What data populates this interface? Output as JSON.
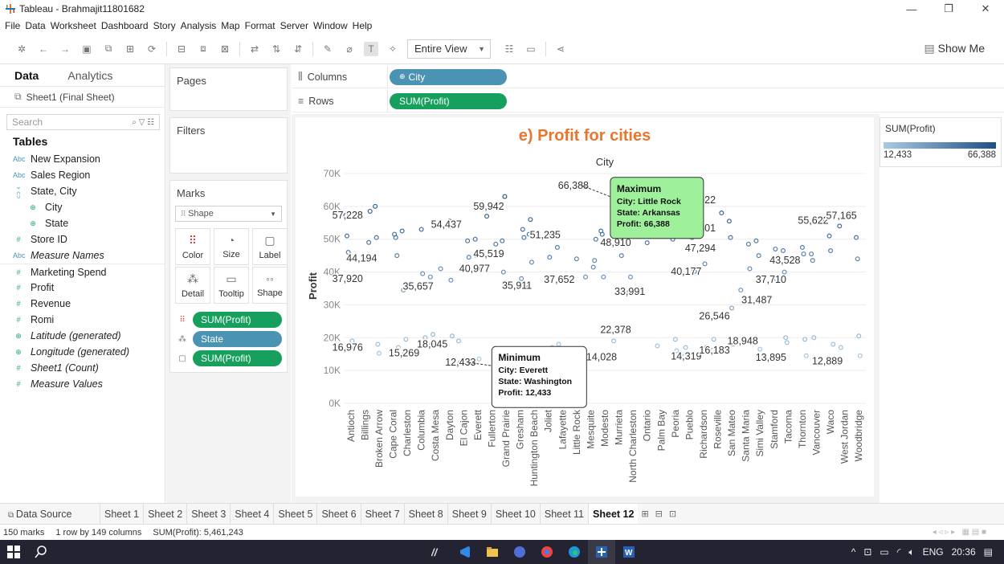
{
  "window": {
    "title": "Tableau - Brahmajit11801682",
    "minimize": "—",
    "restore": "❐",
    "close": "✕"
  },
  "menu": [
    "File",
    "Data",
    "Worksheet",
    "Dashboard",
    "Story",
    "Analysis",
    "Map",
    "Format",
    "Server",
    "Window",
    "Help"
  ],
  "toolbar": {
    "fit": "Entire View",
    "show_me": "Show Me"
  },
  "datapane": {
    "tab_data": "Data",
    "tab_analytics": "Analytics",
    "datasource": "Sheet1 (Final Sheet)",
    "search_placeholder": "Search",
    "tables_header": "Tables",
    "fields": [
      {
        "name": "New Expansion",
        "type": "Abc",
        "indent": false,
        "italic": false
      },
      {
        "name": "Sales Region",
        "type": "Abc",
        "indent": false,
        "italic": false
      },
      {
        "name": "State, City",
        "type": "hier",
        "indent": false,
        "italic": false
      },
      {
        "name": "City",
        "type": "geo",
        "indent": true,
        "italic": false
      },
      {
        "name": "State",
        "type": "geo",
        "indent": true,
        "italic": false
      },
      {
        "name": "Store ID",
        "type": "#",
        "indent": false,
        "italic": false
      },
      {
        "name": "Measure Names",
        "type": "Abc",
        "indent": false,
        "italic": true
      },
      {
        "name": "Marketing Spend",
        "type": "#",
        "indent": false,
        "italic": false
      },
      {
        "name": "Profit",
        "type": "#",
        "indent": false,
        "italic": false
      },
      {
        "name": "Revenue",
        "type": "#",
        "indent": false,
        "italic": false
      },
      {
        "name": "Romi",
        "type": "#",
        "indent": false,
        "italic": false
      },
      {
        "name": "Latitude (generated)",
        "type": "geo",
        "indent": false,
        "italic": true
      },
      {
        "name": "Longitude (generated)",
        "type": "geo",
        "indent": false,
        "italic": true
      },
      {
        "name": "Sheet1 (Count)",
        "type": "#",
        "indent": false,
        "italic": true
      },
      {
        "name": "Measure Values",
        "type": "#",
        "indent": false,
        "italic": true
      }
    ]
  },
  "cards": {
    "pages": "Pages",
    "filters": "Filters",
    "marks": "Marks",
    "mark_type": "Shape",
    "mark_buttons": [
      "Color",
      "Size",
      "Label",
      "Detail",
      "Tooltip",
      "Shape"
    ],
    "mark_pills": [
      {
        "icon": "color",
        "label": "SUM(Profit)",
        "kind": "green"
      },
      {
        "icon": "detail",
        "label": "State",
        "kind": "blue"
      },
      {
        "icon": "label",
        "label": "SUM(Profit)",
        "kind": "green"
      }
    ]
  },
  "shelves": {
    "columns_label": "Columns",
    "columns_pill": "City",
    "rows_label": "Rows",
    "rows_pill": "SUM(Profit)"
  },
  "legend": {
    "title": "SUM(Profit)",
    "min": "12,433",
    "max": "66,388"
  },
  "chart_data": {
    "type": "scatter",
    "title": "e) Profit for cities",
    "xlabel": "City",
    "ylabel": "Profit",
    "ylim": [
      0,
      70000
    ],
    "yticks": [
      "0K",
      "10K",
      "20K",
      "30K",
      "40K",
      "50K",
      "60K",
      "70K"
    ],
    "grid": true,
    "categories": [
      "Antioch",
      "Billings",
      "Broken Arrow",
      "Cape Coral",
      "Charleston",
      "Columbia",
      "Costa Mesa",
      "Dayton",
      "El Cajon",
      "Everett",
      "Fullerton",
      "Grand Prairie",
      "Gresham",
      "Huntington Beach",
      "Joliet",
      "Lafayette",
      "Little Rock",
      "Mesquite",
      "Modesto",
      "Murrieta",
      "North Charleston",
      "Ontario",
      "Palm Bay",
      "Peoria",
      "Pueblo",
      "Richardson",
      "Roseville",
      "San Mateo",
      "Santa Maria",
      "Simi Valley",
      "Stamford",
      "Tacoma",
      "Thornton",
      "Vancouver",
      "Waco",
      "West Jordan",
      "Woodbridge"
    ],
    "labels": [
      {
        "x": 0,
        "y": 57228,
        "text": "57,228"
      },
      {
        "x": 1,
        "y": 44194,
        "text": "44,194"
      },
      {
        "x": 0,
        "y": 37920,
        "text": "37,920"
      },
      {
        "x": 0,
        "y": 16976,
        "text": "16,976"
      },
      {
        "x": 4,
        "y": 15269,
        "text": "15,269"
      },
      {
        "x": 6,
        "y": 18045,
        "text": "18,045"
      },
      {
        "x": 5,
        "y": 35657,
        "text": "35,657"
      },
      {
        "x": 7,
        "y": 54437,
        "text": "54,437"
      },
      {
        "x": 10,
        "y": 59942,
        "text": "59,942"
      },
      {
        "x": 10,
        "y": 45519,
        "text": "45,519"
      },
      {
        "x": 9,
        "y": 40977,
        "text": "40,977"
      },
      {
        "x": 8,
        "y": 12433,
        "text": "12,433"
      },
      {
        "x": 12,
        "y": 35911,
        "text": "35,911"
      },
      {
        "x": 14,
        "y": 51235,
        "text": "51,235"
      },
      {
        "x": 15,
        "y": 37652,
        "text": "37,652"
      },
      {
        "x": 16,
        "y": 66388,
        "text": "66,388"
      },
      {
        "x": 19,
        "y": 48910,
        "text": "48,910"
      },
      {
        "x": 20,
        "y": 33991,
        "text": "33,991"
      },
      {
        "x": 19,
        "y": 22378,
        "text": "22,378"
      },
      {
        "x": 18,
        "y": 14028,
        "text": "14,028"
      },
      {
        "x": 25,
        "y": 61922,
        "text": "61,922"
      },
      {
        "x": 25,
        "y": 53301,
        "text": "53,301"
      },
      {
        "x": 25,
        "y": 47294,
        "text": "47,294"
      },
      {
        "x": 24,
        "y": 40177,
        "text": "40,177"
      },
      {
        "x": 26,
        "y": 26546,
        "text": "26,546"
      },
      {
        "x": 24,
        "y": 14319,
        "text": "14,319"
      },
      {
        "x": 26,
        "y": 16183,
        "text": "16,183"
      },
      {
        "x": 28,
        "y": 18948,
        "text": "18,948"
      },
      {
        "x": 29,
        "y": 31487,
        "text": "31,487"
      },
      {
        "x": 30,
        "y": 37710,
        "text": "37,710"
      },
      {
        "x": 31,
        "y": 43528,
        "text": "43,528"
      },
      {
        "x": 33,
        "y": 55622,
        "text": "55,622"
      },
      {
        "x": 35,
        "y": 57165,
        "text": "57,165"
      },
      {
        "x": 30,
        "y": 13895,
        "text": "13,895"
      },
      {
        "x": 34,
        "y": 12889,
        "text": "12,889"
      }
    ],
    "points": [
      [
        0,
        57228
      ],
      [
        0,
        51000
      ],
      [
        0,
        46000
      ],
      [
        0,
        37920
      ],
      [
        0,
        16976
      ],
      [
        0,
        19000
      ],
      [
        1,
        44194
      ],
      [
        1,
        49000
      ],
      [
        1,
        58500
      ],
      [
        1,
        17500
      ],
      [
        2,
        60000
      ],
      [
        2,
        50500
      ],
      [
        2,
        18000
      ],
      [
        2,
        15269
      ],
      [
        3,
        51500
      ],
      [
        3,
        50500
      ],
      [
        3,
        45000
      ],
      [
        3,
        17000
      ],
      [
        4,
        52500
      ],
      [
        4,
        34500
      ],
      [
        4,
        15269
      ],
      [
        4,
        19500
      ],
      [
        5,
        53000
      ],
      [
        5,
        39500
      ],
      [
        5,
        35657
      ],
      [
        5,
        20000
      ],
      [
        6,
        41000
      ],
      [
        6,
        38500
      ],
      [
        6,
        18045
      ],
      [
        6,
        21000
      ],
      [
        7,
        54437
      ],
      [
        7,
        55500
      ],
      [
        7,
        37500
      ],
      [
        7,
        20500
      ],
      [
        8,
        49500
      ],
      [
        8,
        44500
      ],
      [
        8,
        19000
      ],
      [
        8,
        12433
      ],
      [
        9,
        50000
      ],
      [
        9,
        45000
      ],
      [
        9,
        40977
      ],
      [
        9,
        13500
      ],
      [
        10,
        59942
      ],
      [
        10,
        48500
      ],
      [
        10,
        45519
      ],
      [
        10,
        57000
      ],
      [
        11,
        49500
      ],
      [
        11,
        40000
      ],
      [
        11,
        63000
      ],
      [
        11,
        14500
      ],
      [
        12,
        38000
      ],
      [
        12,
        53000
      ],
      [
        12,
        50500
      ],
      [
        12,
        35911
      ],
      [
        13,
        51500
      ],
      [
        13,
        56000
      ],
      [
        13,
        43000
      ],
      [
        13,
        14000
      ],
      [
        14,
        51235
      ],
      [
        14,
        44500
      ],
      [
        14,
        13500
      ],
      [
        14,
        17000
      ],
      [
        15,
        37652
      ],
      [
        15,
        47500
      ],
      [
        15,
        18000
      ],
      [
        15,
        15000
      ],
      [
        16,
        66388
      ],
      [
        16,
        44000
      ],
      [
        16,
        15500
      ],
      [
        17,
        41500
      ],
      [
        17,
        43500
      ],
      [
        17,
        50000
      ],
      [
        17,
        38500
      ],
      [
        18,
        52500
      ],
      [
        18,
        51500
      ],
      [
        18,
        38500
      ],
      [
        18,
        14028
      ],
      [
        19,
        48910
      ],
      [
        19,
        45000
      ],
      [
        19,
        56000
      ],
      [
        19,
        22378
      ],
      [
        19,
        19000
      ],
      [
        20,
        33991
      ],
      [
        20,
        38500
      ],
      [
        20,
        57500
      ],
      [
        21,
        48910
      ],
      [
        21,
        53000
      ],
      [
        21,
        61500
      ],
      [
        22,
        60500
      ],
      [
        22,
        62000
      ],
      [
        22,
        55000
      ],
      [
        22,
        17500
      ],
      [
        23,
        50000
      ],
      [
        23,
        58000
      ],
      [
        23,
        19500
      ],
      [
        23,
        16000
      ],
      [
        24,
        50500
      ],
      [
        24,
        41000
      ],
      [
        24,
        40177
      ],
      [
        24,
        14319
      ],
      [
        24,
        17000
      ],
      [
        25,
        61922
      ],
      [
        25,
        53301
      ],
      [
        25,
        47294
      ],
      [
        25,
        42500
      ],
      [
        25,
        17000
      ],
      [
        26,
        58000
      ],
      [
        26,
        26546
      ],
      [
        26,
        16183
      ],
      [
        26,
        19500
      ],
      [
        27,
        55500
      ],
      [
        27,
        50500
      ],
      [
        27,
        29000
      ],
      [
        27,
        18000
      ],
      [
        28,
        48500
      ],
      [
        28,
        41000
      ],
      [
        28,
        18948
      ],
      [
        28,
        34500
      ],
      [
        29,
        49500
      ],
      [
        29,
        31487
      ],
      [
        29,
        45000
      ],
      [
        29,
        16500
      ],
      [
        30,
        47000
      ],
      [
        30,
        37710
      ],
      [
        30,
        44500
      ],
      [
        30,
        13895
      ],
      [
        31,
        46500
      ],
      [
        31,
        40000
      ],
      [
        31,
        20000
      ],
      [
        31,
        18500
      ],
      [
        32,
        47500
      ],
      [
        32,
        45500
      ],
      [
        32,
        19500
      ],
      [
        32,
        14500
      ],
      [
        33,
        55622
      ],
      [
        33,
        45500
      ],
      [
        33,
        43528
      ],
      [
        33,
        20000
      ],
      [
        34,
        51000
      ],
      [
        34,
        46500
      ],
      [
        34,
        12889
      ],
      [
        34,
        18000
      ],
      [
        35,
        57165
      ],
      [
        35,
        58000
      ],
      [
        35,
        54000
      ],
      [
        35,
        17000
      ],
      [
        36,
        50500
      ],
      [
        36,
        44000
      ],
      [
        36,
        20500
      ],
      [
        36,
        14500
      ]
    ],
    "tooltips": [
      {
        "kind": "maximum",
        "x": 16,
        "y": 66388,
        "heading": "Maximum",
        "lines": [
          "City: Little Rock",
          "State: Arkansas",
          "Profit: 66,388"
        ]
      },
      {
        "kind": "minimum",
        "x": 8,
        "y": 12433,
        "heading": "Minimum",
        "lines": [
          "City: Everett",
          "State: Washington",
          "Profit: 12,433"
        ]
      }
    ]
  },
  "sheettabs": {
    "datasource": "Data Source",
    "sheets": [
      "Sheet 1",
      "Sheet 2",
      "Sheet 3",
      "Sheet 4",
      "Sheet 5",
      "Sheet 6",
      "Sheet 7",
      "Sheet 8",
      "Sheet 9",
      "Sheet 10",
      "Sheet 11",
      "Sheet 12"
    ],
    "active": "Sheet 12"
  },
  "status": {
    "marks": "150 marks",
    "dims": "1 row by 149 columns",
    "sum": "SUM(Profit): 5,461,243"
  },
  "taskbar": {
    "time": "20:36",
    "lang": "ENG"
  }
}
